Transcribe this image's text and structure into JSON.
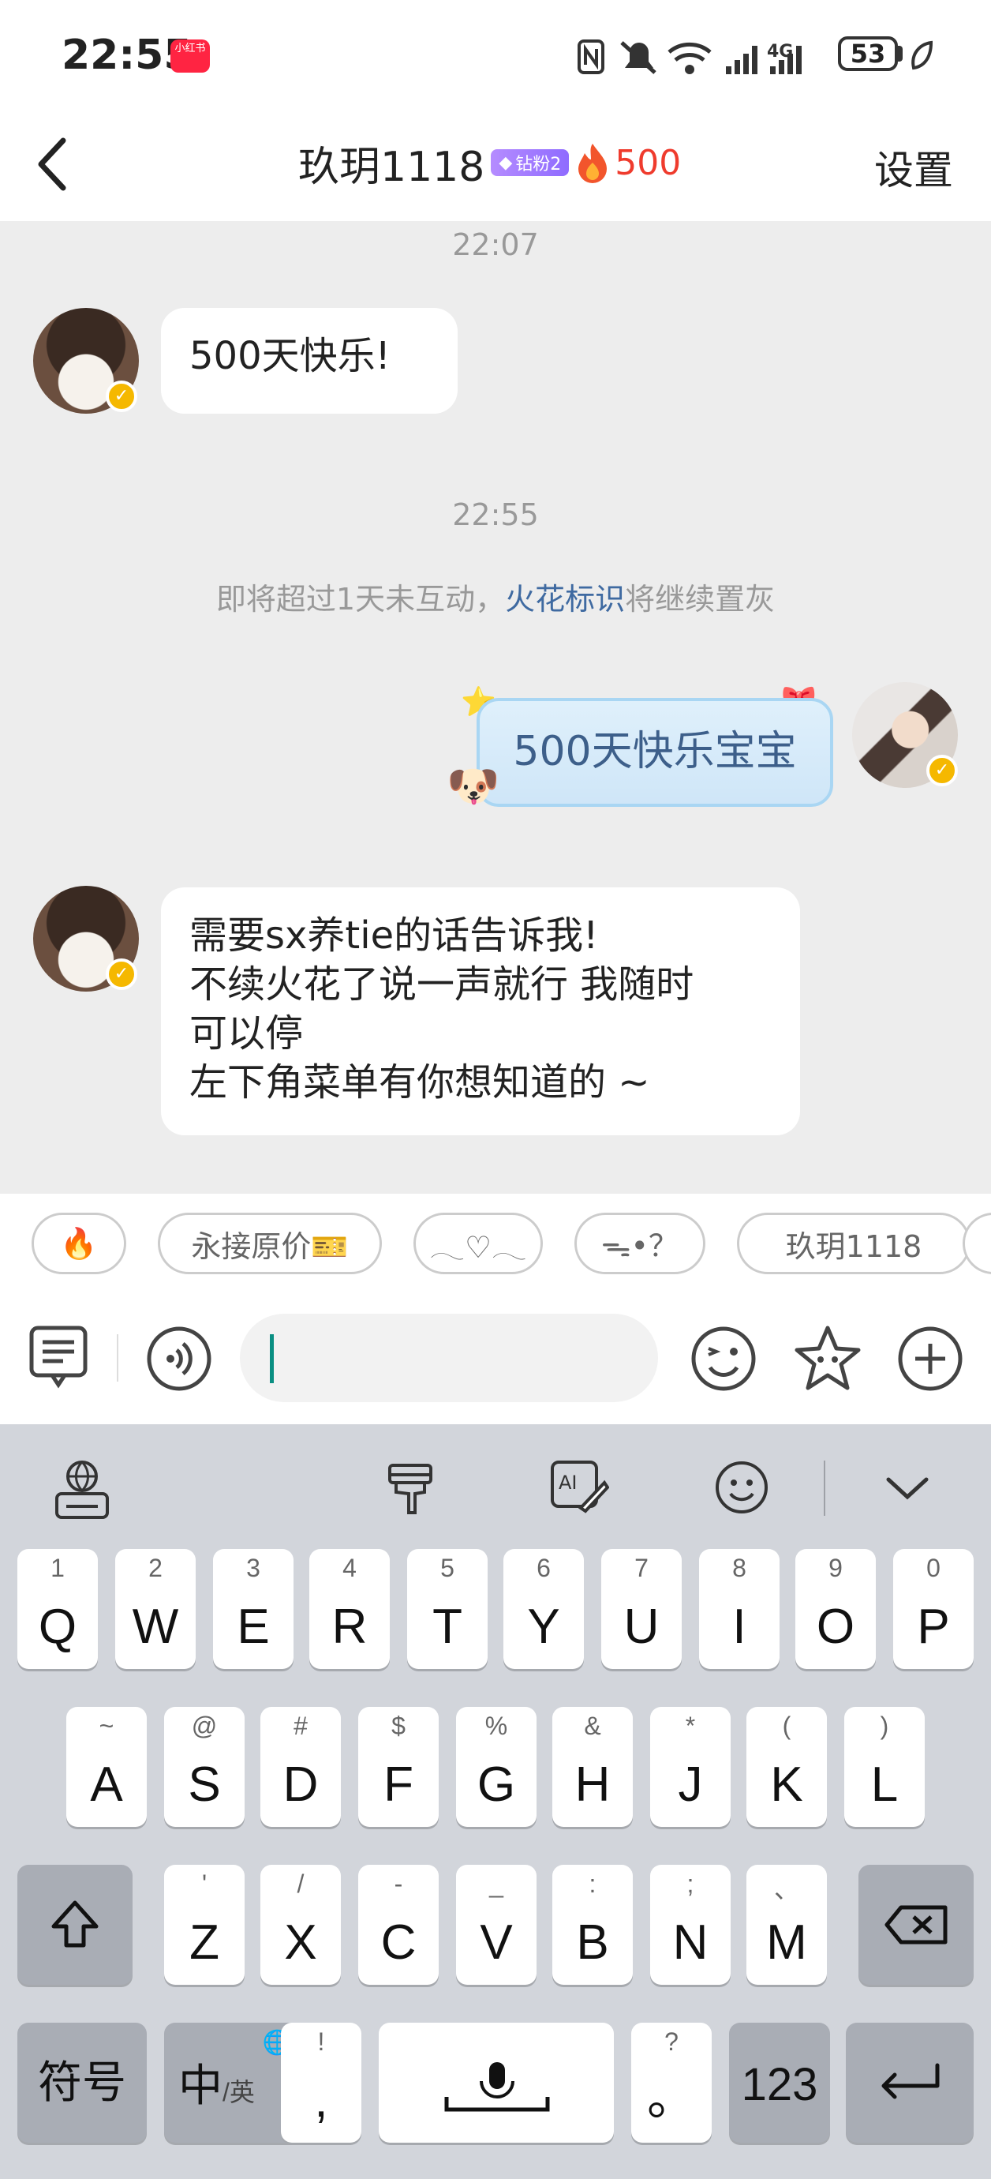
{
  "status_bar": {
    "time": "22:55",
    "app_badge": "小红书",
    "battery": "53"
  },
  "header": {
    "title": "玖玥1118",
    "fan_badge": "钻粉2",
    "flame_count": "500",
    "settings": "设置"
  },
  "messages": {
    "time1": "22:07",
    "msg1": "500天快乐!",
    "time2": "22:55",
    "notice_pre": "即将超过1天未互动，",
    "notice_link": "火花标识",
    "notice_post": "将继续置灰",
    "msg2": "500天快乐宝宝",
    "msg3_lines": [
      "需要sx养tie的话告诉我!",
      "不续火花了说一声就行 我随时",
      "可以停",
      "左下角菜单有你想知道的 ~"
    ]
  },
  "chips": [
    "🔥",
    "永接原价🎫",
    "𓂃♡𓂃",
    "ᯓ•？",
    "玖玥1118"
  ],
  "input": {
    "placeholder": ""
  },
  "keyboard": {
    "row1": [
      [
        "1",
        "Q"
      ],
      [
        "2",
        "W"
      ],
      [
        "3",
        "E"
      ],
      [
        "4",
        "R"
      ],
      [
        "5",
        "T"
      ],
      [
        "6",
        "Y"
      ],
      [
        "7",
        "U"
      ],
      [
        "8",
        "I"
      ],
      [
        "9",
        "O"
      ],
      [
        "0",
        "P"
      ]
    ],
    "row2": [
      [
        "~",
        "A"
      ],
      [
        "@",
        "S"
      ],
      [
        "#",
        "D"
      ],
      [
        "$",
        "F"
      ],
      [
        "%",
        "G"
      ],
      [
        "&",
        "H"
      ],
      [
        "*",
        "J"
      ],
      [
        "(",
        "K"
      ],
      [
        ")",
        "L"
      ]
    ],
    "row3": [
      [
        "'",
        "Z"
      ],
      [
        "/",
        "X"
      ],
      [
        "-",
        "C"
      ],
      [
        "_",
        "V"
      ],
      [
        ":",
        "B"
      ],
      [
        ";",
        "N"
      ],
      [
        "、",
        "M"
      ]
    ],
    "symbols": "符号",
    "lang": "中",
    "lang_sub": "/英",
    "comma_sub": "!",
    "comma": ",",
    "period_sub": "?",
    "period": "。",
    "num": "123"
  }
}
